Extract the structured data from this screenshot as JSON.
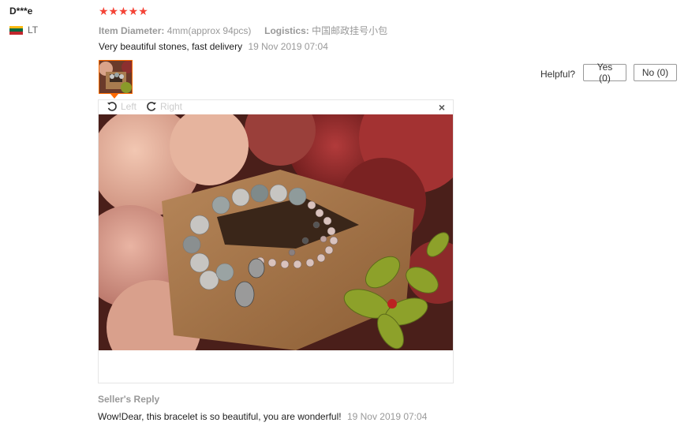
{
  "reviewer": {
    "name": "D***e",
    "country": "LT",
    "flag_colors": [
      "#fdb913",
      "#006a44",
      "#c1272d"
    ]
  },
  "rating": {
    "stars": 5,
    "max": 5,
    "star_glyphs": "★★★★★",
    "color": "#f44336"
  },
  "properties": [
    {
      "label": "Item Diameter:",
      "value": "4mm(approx 94pcs)"
    },
    {
      "label": "Logistics:",
      "value": "中国邮政挂号小包"
    }
  ],
  "review": {
    "text": "Very beautiful stones, fast delivery",
    "date": "19 Nov 2019 07:04"
  },
  "helpful": {
    "label": "Helpful?",
    "yes_label": "Yes (0)",
    "no_label": "No (0)"
  },
  "viewer": {
    "rotate_left_label": "Left",
    "rotate_right_label": "Right",
    "close_glyph": "×"
  },
  "seller_reply": {
    "title": "Seller's Reply",
    "text": "Wow!Dear, this bracelet is so beautiful, you are wonderful!",
    "date": "19 Nov 2019 07:04"
  }
}
